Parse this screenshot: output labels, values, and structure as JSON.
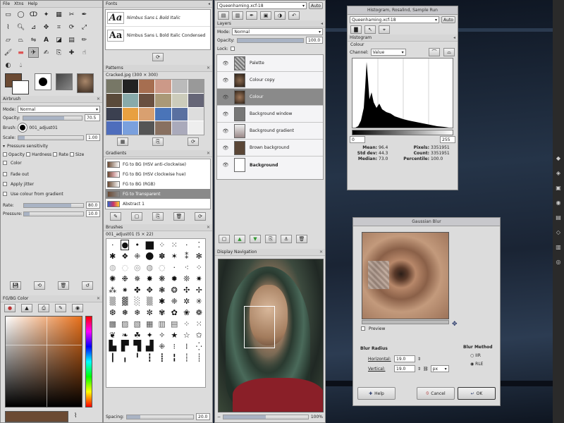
{
  "toolbox": {
    "menu": [
      "File",
      "Xtns",
      "Help"
    ],
    "airbrush_header": "Airbrush",
    "mode_label": "Mode:",
    "mode_value": "Normal",
    "opacity_label": "Opacity:",
    "opacity_value": "70.5",
    "brush_label": "Brush:",
    "brush_value": "001_adjust01",
    "scale_label": "Scale:",
    "scale_value": "1.00",
    "pressure_label": "Pressure sensitivity",
    "pressure_opts": [
      "Opacity",
      "Hardness",
      "Rate",
      "Size"
    ],
    "color_label": "Color",
    "fade_label": "Fade out",
    "jitter_label": "Apply jitter",
    "gradient_label": "Use colour from gradient",
    "rate_label": "Rate:",
    "rate_value": "80.0",
    "rate_level": 0.8,
    "pressure_slider_label": "Pressure:",
    "pressure_value": "10.0",
    "fgbg_header": "FG/BG Color"
  },
  "fonts": {
    "header": "Fonts",
    "items": [
      "Nimbus Sans L Bold Italic",
      "Nimbus Sans L Bold Italic Condensed"
    ],
    "sample": "Aa"
  },
  "patterns": {
    "header": "Patterns",
    "caption": "Cracked.jpg (300 × 300)"
  },
  "gradients": {
    "header": "Gradients",
    "items": [
      "FG to BG (HSV anti-clockwise)",
      "FG to BG (HSV clockwise hue)",
      "FG to BG (RGB)",
      "FG to Transparent",
      "Abstract 1"
    ]
  },
  "brushes": {
    "header": "Brushes",
    "caption": "001_adjust01 (5 × 22)",
    "spacing_label": "Spacing:",
    "spacing_value": "20.0"
  },
  "layers": {
    "image_select": "Queenhaming.xcf-18",
    "auto": "Auto",
    "header": "Layers",
    "mode_label": "Mode:",
    "mode_value": "Normal",
    "opacity_label": "Opacity:",
    "opacity_value": "100.0",
    "lock_label": "Lock:",
    "items": [
      "Palette",
      "Colour copy",
      "Colour",
      "Background window",
      "Background gradient",
      "Brown background",
      "Background"
    ]
  },
  "navigation": {
    "header": "Display Navigation",
    "zoom": "100%"
  },
  "histogram_dialog": {
    "title": "Histogram, Rosalind, Sample Run",
    "image_select": "Queenhaming.xcf-18",
    "auto": "Auto",
    "header": "Histogram",
    "sub": "Colour",
    "channel_label": "Channel:",
    "channel_value": "Value",
    "range_min": "0",
    "range_max": "255",
    "stats": [
      {
        "label": "Mean:",
        "value": "96.4"
      },
      {
        "label": "Std dev:",
        "value": "44.3"
      },
      {
        "label": "Median:",
        "value": "73.0"
      },
      {
        "label": "Pixels:",
        "value": "3351951"
      },
      {
        "label": "Count:",
        "value": "3351951"
      },
      {
        "label": "Percentile:",
        "value": "100.0"
      }
    ]
  },
  "blur_dialog": {
    "title": "Gaussian Blur",
    "preview_label": "Preview",
    "radius_header": "Blur Radius",
    "method_header": "Blur Method",
    "horizontal_label": "Horizontal:",
    "horizontal_value": "19.0",
    "vertical_label": "Vertical:",
    "vertical_value": "19.0",
    "unit": "px",
    "methods": [
      "IIR",
      "RLE"
    ],
    "help": "Help",
    "cancel": "Cancel",
    "ok": "OK"
  },
  "colors": {
    "accent": "#8a8a8a",
    "fg_swatch": "#6b4a33",
    "bg_swatch": "#ffffff"
  }
}
